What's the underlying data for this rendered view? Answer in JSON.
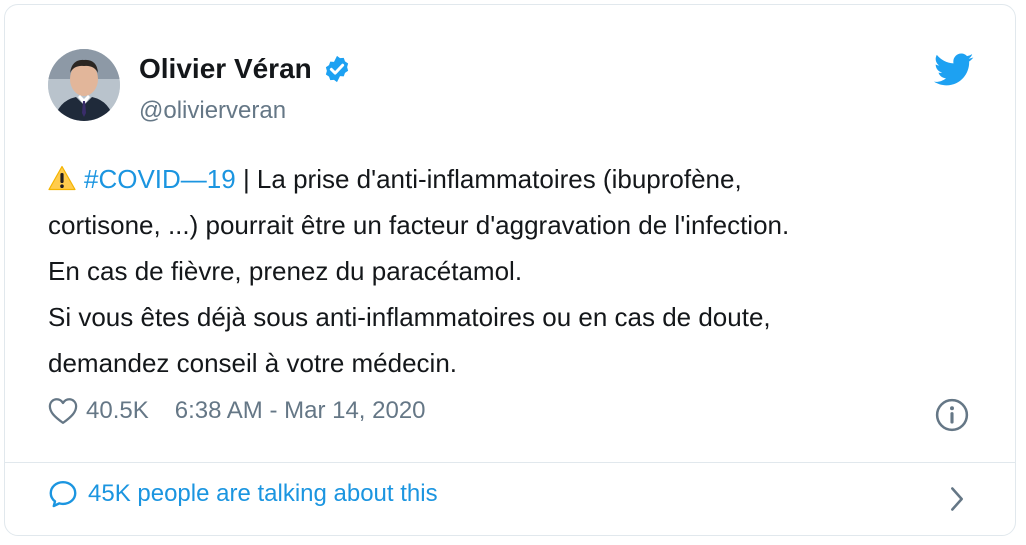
{
  "author": {
    "name": "Olivier Véran",
    "handle": "@olivierveran",
    "verified": true
  },
  "tweet": {
    "hashtag": "#COVID—19",
    "line1_rest": " | La prise d'anti-inflammatoires (ibuprofène,",
    "line2": "cortisone, ...) pourrait être un facteur d'aggravation de l'infection.",
    "line3": "En cas de fièvre, prenez du paracétamol.",
    "line4": "Si vous êtes déjà sous anti-inflammatoires ou en cas de doute,",
    "line5": "demandez conseil à votre médecin."
  },
  "meta": {
    "likes": "40.5K",
    "timestamp": "6:38 AM - Mar 14, 2020"
  },
  "footer": {
    "conversation": "45K people are talking about this"
  },
  "icons": {
    "warning": "warning-icon",
    "verified": "verified-badge-icon",
    "brand": "twitter-bird-icon",
    "like": "heart-icon",
    "info": "info-icon",
    "conversation": "speech-bubble-icon",
    "chevron": "chevron-right-icon"
  },
  "colors": {
    "accent": "#1b95e0",
    "bird": "#1da1f2",
    "text": "#14171a",
    "muted": "#657786",
    "border": "#e1e8ed",
    "warning": "#ffcc4d"
  }
}
